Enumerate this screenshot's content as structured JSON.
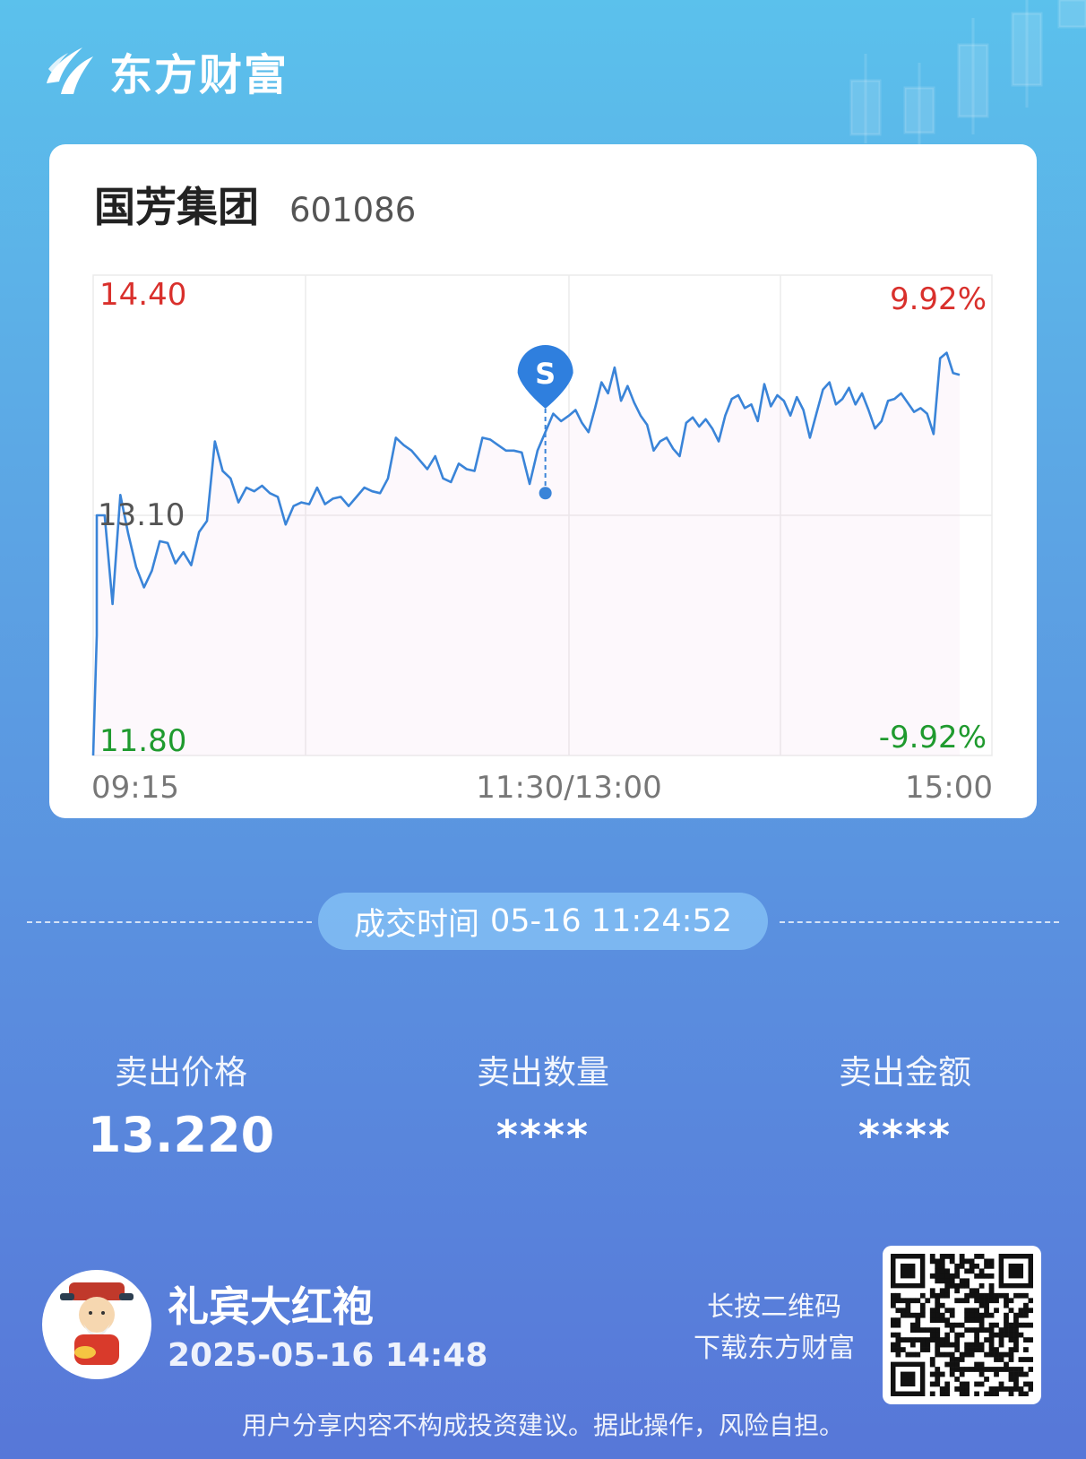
{
  "brand": {
    "name": "东方财富",
    "icon": "eastmoney-logo-icon"
  },
  "stock": {
    "name": "国芳集团",
    "code": "601086"
  },
  "chart_data": {
    "type": "line",
    "title": "",
    "price_high": "14.40",
    "price_prev_close": "13.10",
    "price_low": "11.80",
    "pct_high": "9.92%",
    "pct_low": "-9.92%",
    "x_ticks": [
      "09:15",
      "11:30/13:00",
      "15:00"
    ],
    "ylim": [
      11.8,
      14.4
    ],
    "colors": {
      "line": "#3a84d8",
      "up": "#d9302c",
      "down": "#1f9a2e",
      "neutral": "#555555"
    },
    "marker": {
      "label": "S",
      "time": "11:24",
      "price": 13.22
    },
    "series": [
      {
        "times": [
          "09:15",
          "09:25",
          "09:30",
          "09:32",
          "09:34",
          "09:36",
          "09:38",
          "09:40",
          "09:42",
          "09:44",
          "09:46",
          "09:48",
          "09:50",
          "09:52",
          "09:54",
          "09:56",
          "09:58",
          "10:00",
          "10:02",
          "10:04",
          "10:06",
          "10:08",
          "10:10",
          "10:12",
          "10:14",
          "10:16",
          "10:18",
          "10:20",
          "10:22",
          "10:24",
          "10:26",
          "10:28",
          "10:30",
          "10:32",
          "10:34",
          "10:36",
          "10:38",
          "10:40",
          "10:42",
          "10:44",
          "10:46",
          "10:48",
          "10:50",
          "10:52",
          "10:54",
          "10:56",
          "10:58",
          "11:00",
          "11:02",
          "11:04",
          "11:06",
          "11:08",
          "11:10",
          "11:12",
          "11:14",
          "11:16",
          "11:18",
          "11:20",
          "11:22",
          "11:24",
          "11:26",
          "11:28",
          "11:30",
          "13:02",
          "13:04",
          "13:06",
          "13:08",
          "13:10",
          "13:12",
          "13:14",
          "13:16",
          "13:18",
          "13:20",
          "13:22",
          "13:24",
          "13:26",
          "13:28",
          "13:30",
          "13:32",
          "13:34",
          "13:36",
          "13:38",
          "13:40",
          "13:42",
          "13:44",
          "13:46",
          "13:48",
          "13:50",
          "13:52",
          "13:54",
          "13:56",
          "13:58",
          "14:00",
          "14:02",
          "14:04",
          "14:06",
          "14:08",
          "14:10",
          "14:12",
          "14:14",
          "14:16",
          "14:18",
          "14:20",
          "14:22",
          "14:24",
          "14:26",
          "14:28",
          "14:30",
          "14:32",
          "14:34",
          "14:36",
          "14:38",
          "14:40",
          "14:42",
          "14:44",
          "14:46",
          "14:48",
          "14:50",
          "14:52",
          "14:54",
          "14:56",
          "14:58",
          "15:00"
        ],
        "values": [
          11.8,
          12.45,
          13.1,
          13.1,
          12.62,
          13.21,
          13.0,
          12.82,
          12.71,
          12.8,
          12.96,
          12.95,
          12.84,
          12.9,
          12.83,
          13.01,
          13.07,
          13.5,
          13.34,
          13.3,
          13.17,
          13.25,
          13.23,
          13.26,
          13.22,
          13.2,
          13.05,
          13.15,
          13.17,
          13.16,
          13.25,
          13.16,
          13.19,
          13.2,
          13.15,
          13.2,
          13.25,
          13.23,
          13.22,
          13.3,
          13.52,
          13.48,
          13.45,
          13.4,
          13.35,
          13.42,
          13.3,
          13.28,
          13.38,
          13.35,
          13.34,
          13.52,
          13.51,
          13.48,
          13.45,
          13.45,
          13.44,
          13.27,
          13.45,
          13.55,
          13.65,
          13.61,
          13.64,
          13.67,
          13.6,
          13.55,
          13.68,
          13.82,
          13.76,
          13.9,
          13.72,
          13.8,
          13.71,
          13.64,
          13.59,
          13.45,
          13.5,
          13.52,
          13.46,
          13.42,
          13.6,
          13.63,
          13.58,
          13.62,
          13.57,
          13.5,
          13.64,
          13.73,
          13.75,
          13.68,
          13.7,
          13.61,
          13.81,
          13.69,
          13.75,
          13.72,
          13.64,
          13.74,
          13.67,
          13.52,
          13.65,
          13.78,
          13.82,
          13.7,
          13.73,
          13.79,
          13.7,
          13.76,
          13.67,
          13.57,
          13.61,
          13.72,
          13.73,
          13.76,
          13.71,
          13.66,
          13.68,
          13.65,
          13.54,
          13.95,
          13.98,
          13.87,
          13.86,
          13.9,
          13.93,
          13.9
        ]
      }
    ]
  },
  "trade": {
    "time_label": "成交时间",
    "time_value": "05-16 11:24:52"
  },
  "stats": {
    "price_label": "卖出价格",
    "price_value": "13.220",
    "qty_label": "卖出数量",
    "qty_value": "****",
    "amount_label": "卖出金额",
    "amount_value": "****"
  },
  "footer": {
    "user_name": "礼宾大红袍",
    "share_time": "2025-05-16 14:48",
    "qr_hint_line1": "长按二维码",
    "qr_hint_line2": "下载东方财富",
    "disclaimer": "用户分享内容不构成投资建议。据此操作，风险自担。"
  }
}
